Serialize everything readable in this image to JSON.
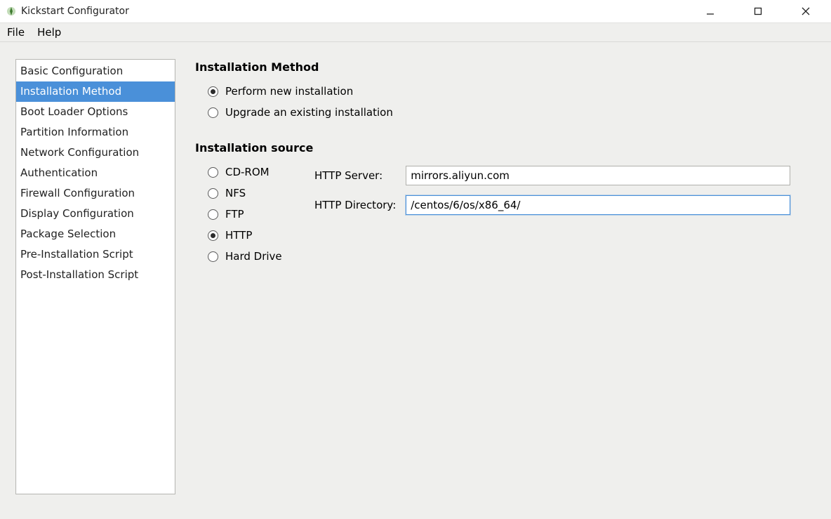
{
  "window": {
    "title": "Kickstart Configurator"
  },
  "menubar": {
    "file": "File",
    "help": "Help"
  },
  "sidebar": {
    "items": [
      {
        "label": "Basic Configuration",
        "selected": false
      },
      {
        "label": "Installation Method",
        "selected": true
      },
      {
        "label": "Boot Loader Options",
        "selected": false
      },
      {
        "label": "Partition Information",
        "selected": false
      },
      {
        "label": "Network Configuration",
        "selected": false
      },
      {
        "label": "Authentication",
        "selected": false
      },
      {
        "label": "Firewall Configuration",
        "selected": false
      },
      {
        "label": "Display Configuration",
        "selected": false
      },
      {
        "label": "Package Selection",
        "selected": false
      },
      {
        "label": "Pre-Installation Script",
        "selected": false
      },
      {
        "label": "Post-Installation Script",
        "selected": false
      }
    ]
  },
  "main": {
    "method_title": "Installation Method",
    "method_options": {
      "new": {
        "label": "Perform new installation",
        "checked": true
      },
      "upgrade": {
        "label": "Upgrade an existing installation",
        "checked": false
      }
    },
    "source_title": "Installation source",
    "source_options": {
      "cdrom": {
        "label": "CD-ROM",
        "checked": false
      },
      "nfs": {
        "label": "NFS",
        "checked": false
      },
      "ftp": {
        "label": "FTP",
        "checked": false
      },
      "http": {
        "label": "HTTP",
        "checked": true
      },
      "hdd": {
        "label": "Hard Drive",
        "checked": false
      }
    },
    "http": {
      "server_label": "HTTP Server:",
      "server_value": "mirrors.aliyun.com",
      "dir_label": "HTTP Directory:",
      "dir_value": "/centos/6/os/x86_64/"
    }
  }
}
